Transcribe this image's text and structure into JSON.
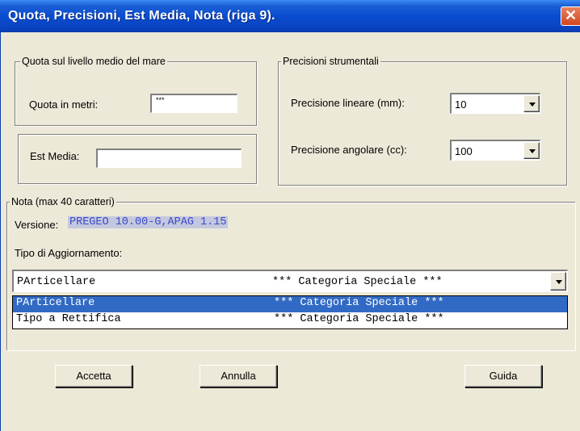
{
  "window": {
    "title": "Quota, Precisioni, Est Media, Nota  (riga 9).",
    "close_glyph": "✕"
  },
  "quota_group": {
    "legend": "Quota sul livello medio del mare",
    "label": "Quota in metri:",
    "value": "***"
  },
  "est_media": {
    "label": "Est Media:",
    "value": ""
  },
  "precisioni_group": {
    "legend": "Precisioni strumentali",
    "lineare_label": "Precisione lineare (mm):",
    "lineare_value": "10",
    "angolare_label": "Precisione  angolare (cc):",
    "angolare_value": "100"
  },
  "nota_group": {
    "legend": "Nota (max 40 caratteri)",
    "versione_label": "Versione:",
    "versione_value": "PREGEO 10.00-G,APAG 1.15",
    "tipo_label": "Tipo di Aggiornamento:",
    "tipo_selected": {
      "name": "PArticellare",
      "category": "*** Categoria Speciale ***"
    },
    "tipo_options": [
      {
        "name": "PArticellare",
        "category": "*** Categoria Speciale ***",
        "selected": true
      },
      {
        "name": "Tipo a Rettifica",
        "category": "*** Categoria Speciale ***",
        "selected": false
      }
    ]
  },
  "buttons": {
    "accetta": "Accetta",
    "annulla": "Annulla",
    "guida": "Guida"
  },
  "colors": {
    "titlebar": "#0a4ccf",
    "selection": "#316ac5",
    "dialog_bg": "#ece9d8",
    "close_button": "#d2461f"
  }
}
